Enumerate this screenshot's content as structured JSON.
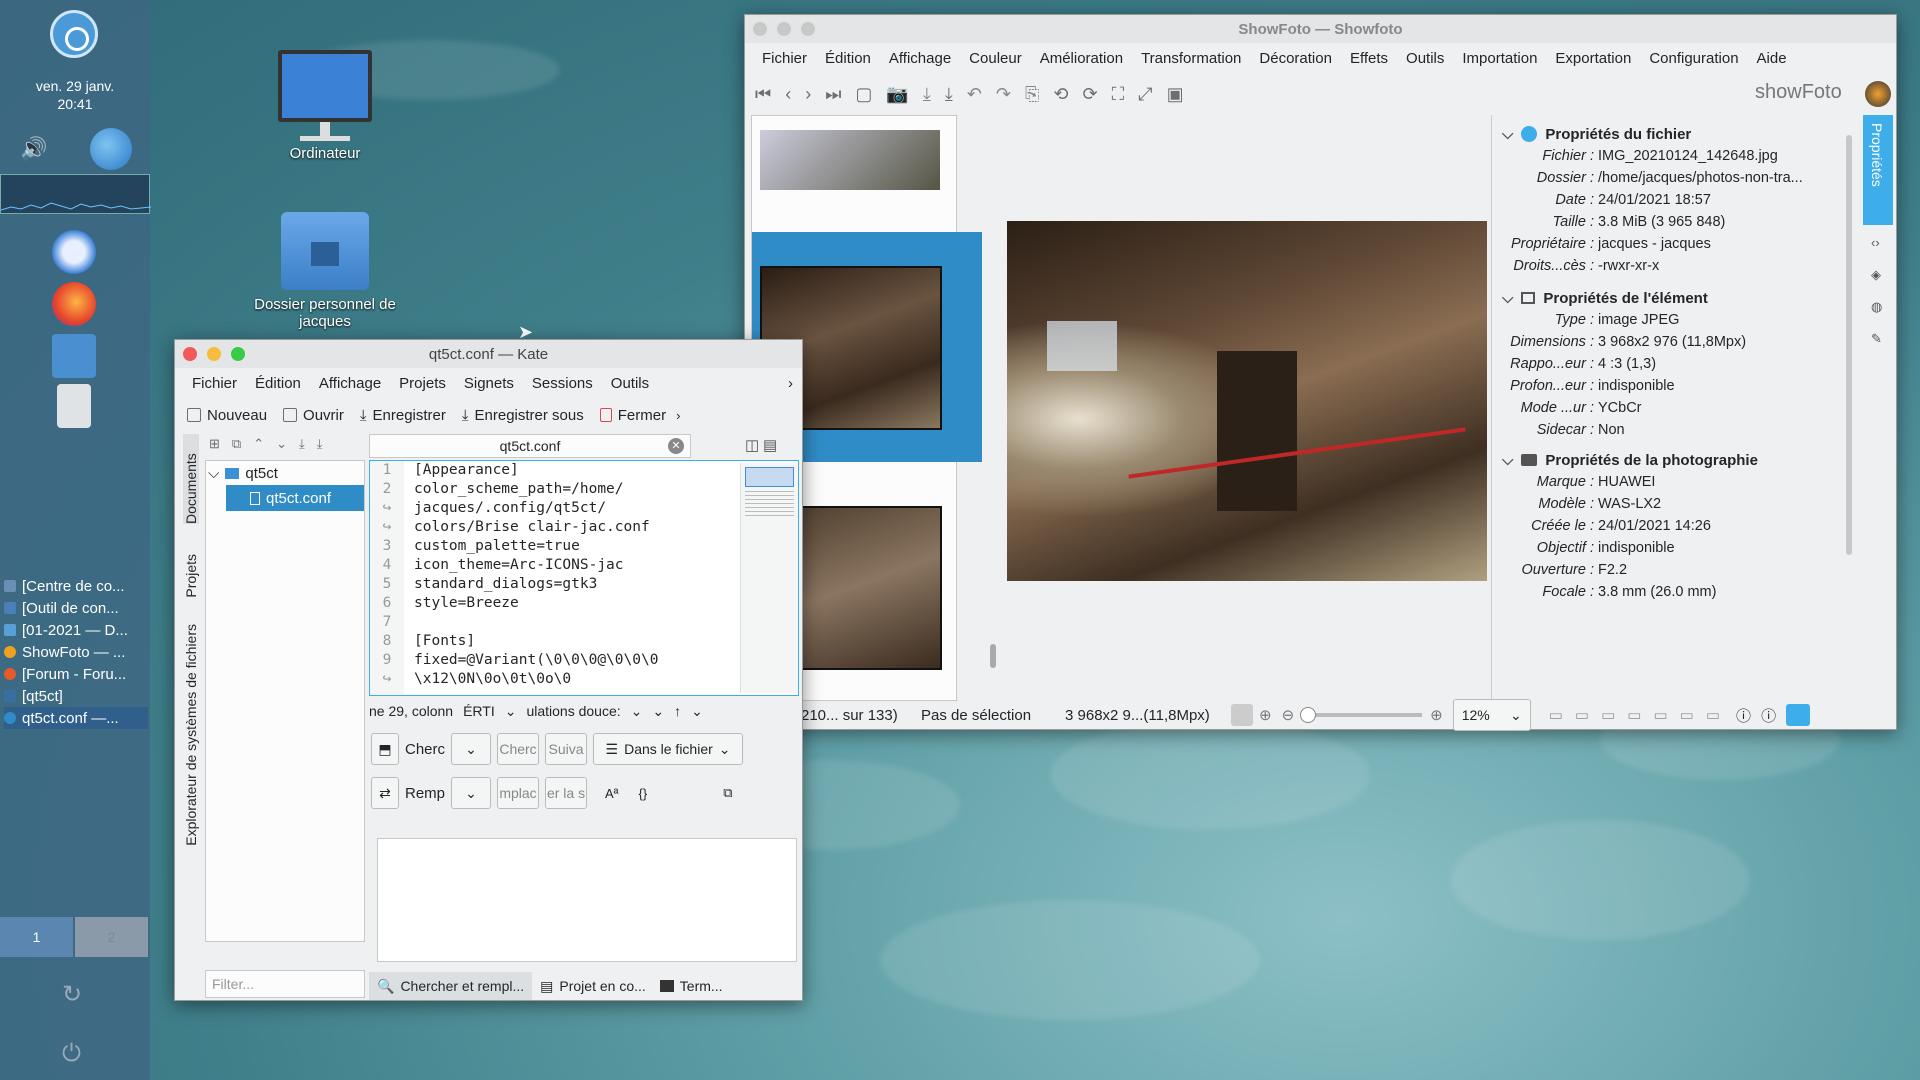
{
  "panel": {
    "date": "ven. 29 janv.",
    "time": "20:41",
    "tasks": [
      "[Centre de co...",
      "[Outil de con...",
      "[01-2021 — D...",
      "ShowFoto — ...",
      "[Forum - Foru...",
      "[qt5ct]",
      "qt5ct.conf —..."
    ],
    "desktops": [
      "1",
      "2"
    ]
  },
  "desktop": {
    "computer": "Ordinateur",
    "home": "Dossier personnel de jacques"
  },
  "kate": {
    "title": "qt5ct.conf — Kate",
    "menu": [
      "Fichier",
      "Édition",
      "Affichage",
      "Projets",
      "Signets",
      "Sessions",
      "Outils"
    ],
    "toolbar": {
      "new": "Nouveau",
      "open": "Ouvrir",
      "save": "Enregistrer",
      "save_as": "Enregistrer sous",
      "close": "Fermer"
    },
    "tab": "qt5ct.conf",
    "side_tabs": {
      "documents": "Documents",
      "projects": "Projets",
      "fs": "Explorateur de systèmes de fichiers"
    },
    "tree": {
      "folder": "qt5ct",
      "file": "qt5ct.conf"
    },
    "line_numbers": [
      "1",
      "2",
      "↪",
      "↪",
      "3",
      "4",
      "5",
      "6",
      "7",
      "8",
      "9",
      "↪"
    ],
    "code_lines": [
      "[Appearance]",
      "color_scheme_path=/home/",
      "jacques/.config/qt5ct/",
      "colors/Brise clair-jac.conf",
      "custom_palette=true",
      "icon_theme=Arc-ICONS-jac",
      "standard_dialogs=gtk3",
      "style=Breeze",
      "",
      "[Fonts]",
      "fixed=@Variant(\\0\\0\\0@\\0\\0\\0",
      "\\x12\\0N\\0o\\0t\\0o\\0"
    ],
    "status": {
      "pos": "ne 29, colonn",
      "mode": "ÉRTI",
      "encoding": "ulations douce:",
      "extra": "↑"
    },
    "search": {
      "find": "Cherc",
      "find_btn": "Cherc",
      "next_btn": "Suiva",
      "scope": "Dans le fichier",
      "replace": "Remp",
      "replace_btn": "mplac",
      "replace_all": "er la s"
    },
    "filter_placeholder": "Filter...",
    "bottom_tabs": [
      "Chercher et rempl...",
      "Projet en co...",
      "Term..."
    ]
  },
  "showfoto": {
    "title": "ShowFoto — Showfoto",
    "menu": [
      "Fichier",
      "Édition",
      "Affichage",
      "Couleur",
      "Amélioration",
      "Transformation",
      "Décoration",
      "Effets",
      "Outils",
      "Importation",
      "Exportation",
      "Configuration",
      "Aide"
    ],
    "brand": "showFoto",
    "side_tab": "Propriétés",
    "sections": [
      {
        "title": "Propriétés du fichier",
        "rows": [
          [
            "Fichier :",
            "IMG_20210124_142648.jpg"
          ],
          [
            "Dossier :",
            "/home/jacques/photos-non-tra..."
          ],
          [
            "Date :",
            "24/01/2021 18:57"
          ],
          [
            "Taille :",
            "3.8 MiB (3 965 848)"
          ],
          [
            "Propriétaire :",
            "jacques - jacques"
          ],
          [
            "Droits...cès :",
            "-rwxr-xr-x"
          ]
        ]
      },
      {
        "title": "Propriétés de l'élément",
        "rows": [
          [
            "Type :",
            "image JPEG"
          ],
          [
            "Dimensions :",
            "3 968x2 976 (11,8Mpx)"
          ],
          [
            "Rappo...eur :",
            "4 :3 (1,3)"
          ],
          [
            "Profon...eur :",
            "indisponible"
          ],
          [
            "Mode ...ur :",
            "YCbCr"
          ],
          [
            "Sidecar :",
            "Non"
          ]
        ]
      },
      {
        "title": "Propriétés de la photographie",
        "rows": [
          [
            "Marque :",
            "HUAWEI"
          ],
          [
            "Modèle :",
            "WAS-LX2"
          ],
          [
            "Créée le :",
            "24/01/2021 14:26"
          ],
          [
            "Objectif :",
            "indisponible"
          ],
          [
            "Ouverture :",
            "F2.2"
          ],
          [
            "Focale :",
            "3.8 mm (26.0 mm)"
          ]
        ]
      }
    ],
    "status": {
      "count": "210... sur 133)",
      "selection": "Pas de sélection",
      "size": "3 968x2 9...(11,8Mpx)",
      "zoom": "12%"
    }
  },
  "colors": {
    "accent": "#3daee9",
    "selected": "#308cc6",
    "close": "#f3595a",
    "min": "#f8bd3c",
    "max": "#39c94b"
  }
}
